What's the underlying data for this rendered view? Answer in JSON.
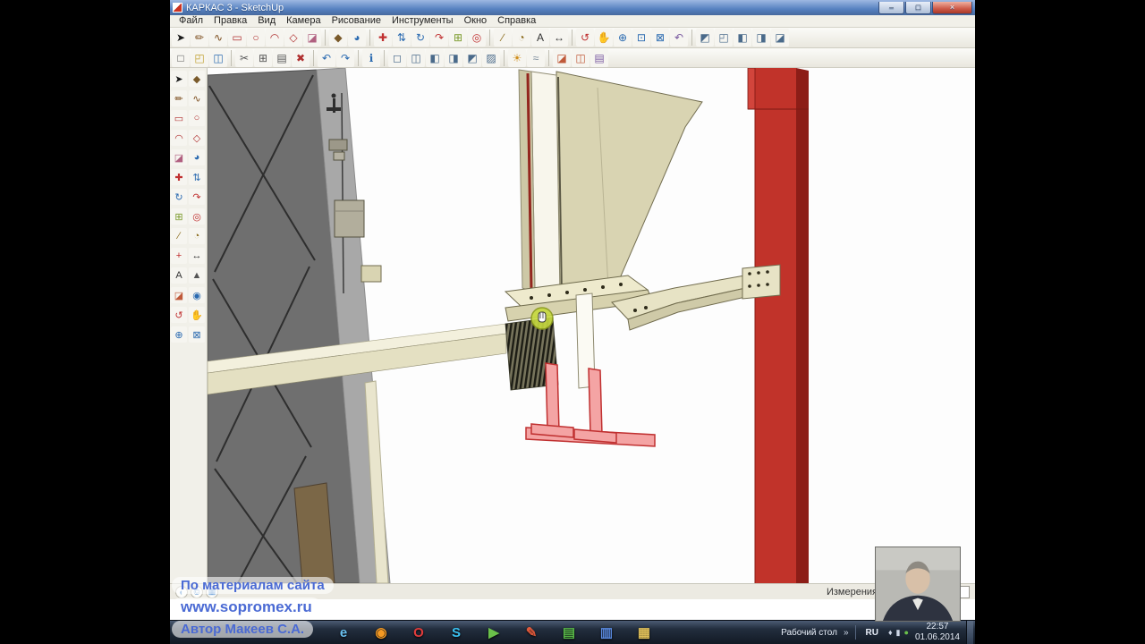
{
  "window": {
    "title": "КАРКАС 3 - SketchUp",
    "buttons": {
      "minimize": "–",
      "maximize": "□",
      "close": "×"
    }
  },
  "menu": {
    "items": [
      "Файл",
      "Правка",
      "Вид",
      "Камера",
      "Рисование",
      "Инструменты",
      "Окно",
      "Справка"
    ]
  },
  "toolbar_row1": [
    {
      "n": "select-tool",
      "g": "➤",
      "c": "#1a1a1a"
    },
    {
      "n": "line-tool",
      "g": "✏",
      "c": "#7a4a1a"
    },
    {
      "n": "freehand-tool",
      "g": "∿",
      "c": "#7a4a1a"
    },
    {
      "n": "rectangle-tool",
      "g": "▭",
      "c": "#b03030"
    },
    {
      "n": "circle-tool",
      "g": "○",
      "c": "#b03030"
    },
    {
      "n": "arc-tool",
      "g": "◠",
      "c": "#b03030"
    },
    {
      "n": "polygon-tool",
      "g": "◇",
      "c": "#b03030"
    },
    {
      "n": "eraser-tool",
      "g": "◪",
      "c": "#b06080"
    },
    {
      "sep": true
    },
    {
      "n": "make-component",
      "g": "◆",
      "c": "#7a5a2a"
    },
    {
      "n": "paint-bucket-tool",
      "g": "◕",
      "c": "#2a6ab0"
    },
    {
      "sep": true
    },
    {
      "n": "move-tool",
      "g": "✚",
      "c": "#c03030"
    },
    {
      "n": "push-pull-tool",
      "g": "⇅",
      "c": "#2a6ab0"
    },
    {
      "n": "rotate-tool",
      "g": "↻",
      "c": "#2a6ab0"
    },
    {
      "n": "follow-me-tool",
      "g": "↷",
      "c": "#c03030"
    },
    {
      "n": "scale-tool",
      "g": "⊞",
      "c": "#7a9a2a"
    },
    {
      "n": "offset-tool",
      "g": "◎",
      "c": "#c03030"
    },
    {
      "sep": true
    },
    {
      "n": "tape-measure-tool",
      "g": "∕",
      "c": "#8a6a1a"
    },
    {
      "n": "protractor-tool",
      "g": "◔",
      "c": "#8a6a1a"
    },
    {
      "n": "text-tool",
      "g": "A",
      "c": "#333333"
    },
    {
      "n": "dimension-tool",
      "g": "↔",
      "c": "#333333"
    },
    {
      "sep": true
    },
    {
      "n": "orbit-tool",
      "g": "↺",
      "c": "#c03030"
    },
    {
      "n": "pan-tool",
      "g": "✋",
      "c": "#d09020"
    },
    {
      "n": "zoom-tool",
      "g": "⊕",
      "c": "#2a6ab0"
    },
    {
      "n": "zoom-window-tool",
      "g": "⊡",
      "c": "#2a6ab0"
    },
    {
      "n": "zoom-extents-tool",
      "g": "⊠",
      "c": "#2a6ab0"
    },
    {
      "n": "previous-view",
      "g": "↶",
      "c": "#7a5aa0"
    },
    {
      "sep": true
    },
    {
      "n": "iso-view",
      "g": "◩",
      "c": "#4a6a8a"
    },
    {
      "n": "top-view",
      "g": "◰",
      "c": "#4a6a8a"
    },
    {
      "n": "front-view",
      "g": "◧",
      "c": "#4a6a8a"
    },
    {
      "n": "right-view",
      "g": "◨",
      "c": "#4a6a8a"
    },
    {
      "n": "back-view",
      "g": "◪",
      "c": "#4a6a8a"
    }
  ],
  "toolbar_row2": [
    {
      "n": "new-file",
      "g": "□",
      "c": "#555555"
    },
    {
      "n": "open-file",
      "g": "◰",
      "c": "#c0a030"
    },
    {
      "n": "save-file",
      "g": "◫",
      "c": "#2a6ab0"
    },
    {
      "sep": true
    },
    {
      "n": "cut",
      "g": "✂",
      "c": "#555555"
    },
    {
      "n": "copy",
      "g": "⊞",
      "c": "#555555"
    },
    {
      "n": "paste",
      "g": "▤",
      "c": "#555555"
    },
    {
      "n": "erase",
      "g": "✖",
      "c": "#b03030"
    },
    {
      "sep": true
    },
    {
      "n": "undo",
      "g": "↶",
      "c": "#2a6ab0"
    },
    {
      "n": "redo",
      "g": "↷",
      "c": "#2a6ab0"
    },
    {
      "sep": true
    },
    {
      "n": "model-info",
      "g": "ℹ",
      "c": "#2a6ab0"
    },
    {
      "sep": true
    },
    {
      "n": "wireframe-style",
      "g": "◻",
      "c": "#4a6a8a"
    },
    {
      "n": "hidden-line-style",
      "g": "◫",
      "c": "#4a6a8a"
    },
    {
      "n": "shaded-style",
      "g": "◧",
      "c": "#4a6a8a"
    },
    {
      "n": "textured-style",
      "g": "◨",
      "c": "#4a6a8a"
    },
    {
      "n": "monochrome-style",
      "g": "◩",
      "c": "#4a6a8a"
    },
    {
      "n": "xray-style",
      "g": "▨",
      "c": "#4a6a8a"
    },
    {
      "sep": true
    },
    {
      "n": "shadows-toggle",
      "g": "☀",
      "c": "#d09020"
    },
    {
      "n": "fog-toggle",
      "g": "≈",
      "c": "#7a8a9a"
    },
    {
      "sep": true
    },
    {
      "n": "section-plane",
      "g": "◪",
      "c": "#c05a3a"
    },
    {
      "n": "section-cuts",
      "g": "◫",
      "c": "#c05a3a"
    },
    {
      "n": "layers-panel",
      "g": "▤",
      "c": "#7a5aa0"
    }
  ],
  "tool_palette": [
    {
      "n": "select-tool",
      "g": "➤",
      "c": "#1a1a1a"
    },
    {
      "n": "make-component",
      "g": "◆",
      "c": "#7a5a2a"
    },
    {
      "n": "line-tool",
      "g": "✏",
      "c": "#7a4a1a"
    },
    {
      "n": "freehand-tool",
      "g": "∿",
      "c": "#7a4a1a"
    },
    {
      "n": "rectangle-tool",
      "g": "▭",
      "c": "#b03030"
    },
    {
      "n": "circle-tool",
      "g": "○",
      "c": "#b03030"
    },
    {
      "n": "arc-tool",
      "g": "◠",
      "c": "#b03030"
    },
    {
      "n": "polygon-tool",
      "g": "◇",
      "c": "#b03030"
    },
    {
      "n": "eraser-tool",
      "g": "◪",
      "c": "#b06080"
    },
    {
      "n": "paint-bucket-tool",
      "g": "◕",
      "c": "#2a6ab0"
    },
    {
      "n": "move-tool",
      "g": "✚",
      "c": "#c03030"
    },
    {
      "n": "push-pull-tool",
      "g": "⇅",
      "c": "#2a6ab0"
    },
    {
      "n": "rotate-tool",
      "g": "↻",
      "c": "#2a6ab0"
    },
    {
      "n": "follow-me-tool",
      "g": "↷",
      "c": "#c03030"
    },
    {
      "n": "scale-tool",
      "g": "⊞",
      "c": "#7a9a2a"
    },
    {
      "n": "offset-tool",
      "g": "◎",
      "c": "#c03030"
    },
    {
      "n": "tape-measure-tool",
      "g": "∕",
      "c": "#8a6a1a"
    },
    {
      "n": "protractor-tool",
      "g": "◔",
      "c": "#8a6a1a"
    },
    {
      "n": "axes-tool",
      "g": "+",
      "c": "#c03030"
    },
    {
      "n": "dimension-tool",
      "g": "↔",
      "c": "#333333"
    },
    {
      "n": "text-tool",
      "g": "A",
      "c": "#333333"
    },
    {
      "n": "3d-text-tool",
      "g": "▲",
      "c": "#555555"
    },
    {
      "n": "section-plane",
      "g": "◪",
      "c": "#c05a3a"
    },
    {
      "n": "look-around-tool",
      "g": "◉",
      "c": "#2a6ab0"
    },
    {
      "n": "orbit-tool",
      "g": "↺",
      "c": "#c03030"
    },
    {
      "n": "pan-tool",
      "g": "✋",
      "c": "#d09020"
    },
    {
      "n": "zoom-tool",
      "g": "⊕",
      "c": "#2a6ab0"
    },
    {
      "n": "zoom-extents-tool",
      "g": "⊠",
      "c": "#2a6ab0"
    }
  ],
  "statusbar": {
    "icons": [
      {
        "n": "geolocation",
        "g": "◐",
        "c": "#4a8ad0"
      },
      {
        "n": "credits",
        "g": "©",
        "c": "#4a8ad0"
      },
      {
        "n": "claim-model",
        "g": "▦",
        "c": "#4a8ad0"
      }
    ],
    "measure_label": "Измерения",
    "measure_value": ""
  },
  "overlay": {
    "line1": "По материалам сайта",
    "line2": "www.sopromex.ru",
    "line3": "Автор Макеев С.А."
  },
  "taskbar": {
    "quick_launch": [
      {
        "n": "internet-explorer",
        "g": "e",
        "c": "#6ac0f0"
      },
      {
        "n": "firefox",
        "g": "◉",
        "c": "#f59a23"
      },
      {
        "n": "opera",
        "g": "O",
        "c": "#e03c3c"
      },
      {
        "n": "skype",
        "g": "S",
        "c": "#3ac0f0"
      },
      {
        "n": "media-player",
        "g": "▶",
        "c": "#6ac04a"
      },
      {
        "n": "paint-app",
        "g": "✎",
        "c": "#e05a3c"
      },
      {
        "n": "excel",
        "g": "▤",
        "c": "#58b848"
      },
      {
        "n": "word-app",
        "g": "▥",
        "c": "#5a8ae0"
      },
      {
        "n": "file-manager",
        "g": "▦",
        "c": "#e0c05a"
      }
    ],
    "tray": {
      "desktop_label": "Рабочий стол",
      "chevrons": "»",
      "lang": "RU",
      "icons": [
        {
          "n": "tray-volume",
          "g": "♦",
          "c": "#cfd8e8"
        },
        {
          "n": "tray-network",
          "g": "▮",
          "c": "#cfd8e8"
        },
        {
          "n": "tray-antivirus",
          "g": "●",
          "c": "#6ac04a"
        }
      ],
      "time": "22:57",
      "date": "01.06.2014"
    }
  },
  "colors": {
    "wall_dark": "#6f6f6f",
    "wall_light": "#a8a8a8",
    "beam_top": "#f3f0dd",
    "beam_front": "#e4e0c2",
    "channel_cream": "#d9d4b2",
    "mullion_white": "#f8f6ec",
    "column_red": "#c1332a",
    "column_red_dark": "#8c1d17",
    "purlin_pink": "#f4a4a4",
    "purlin_stroke": "#c03030",
    "cursor_highlight": "#c6d93f"
  }
}
